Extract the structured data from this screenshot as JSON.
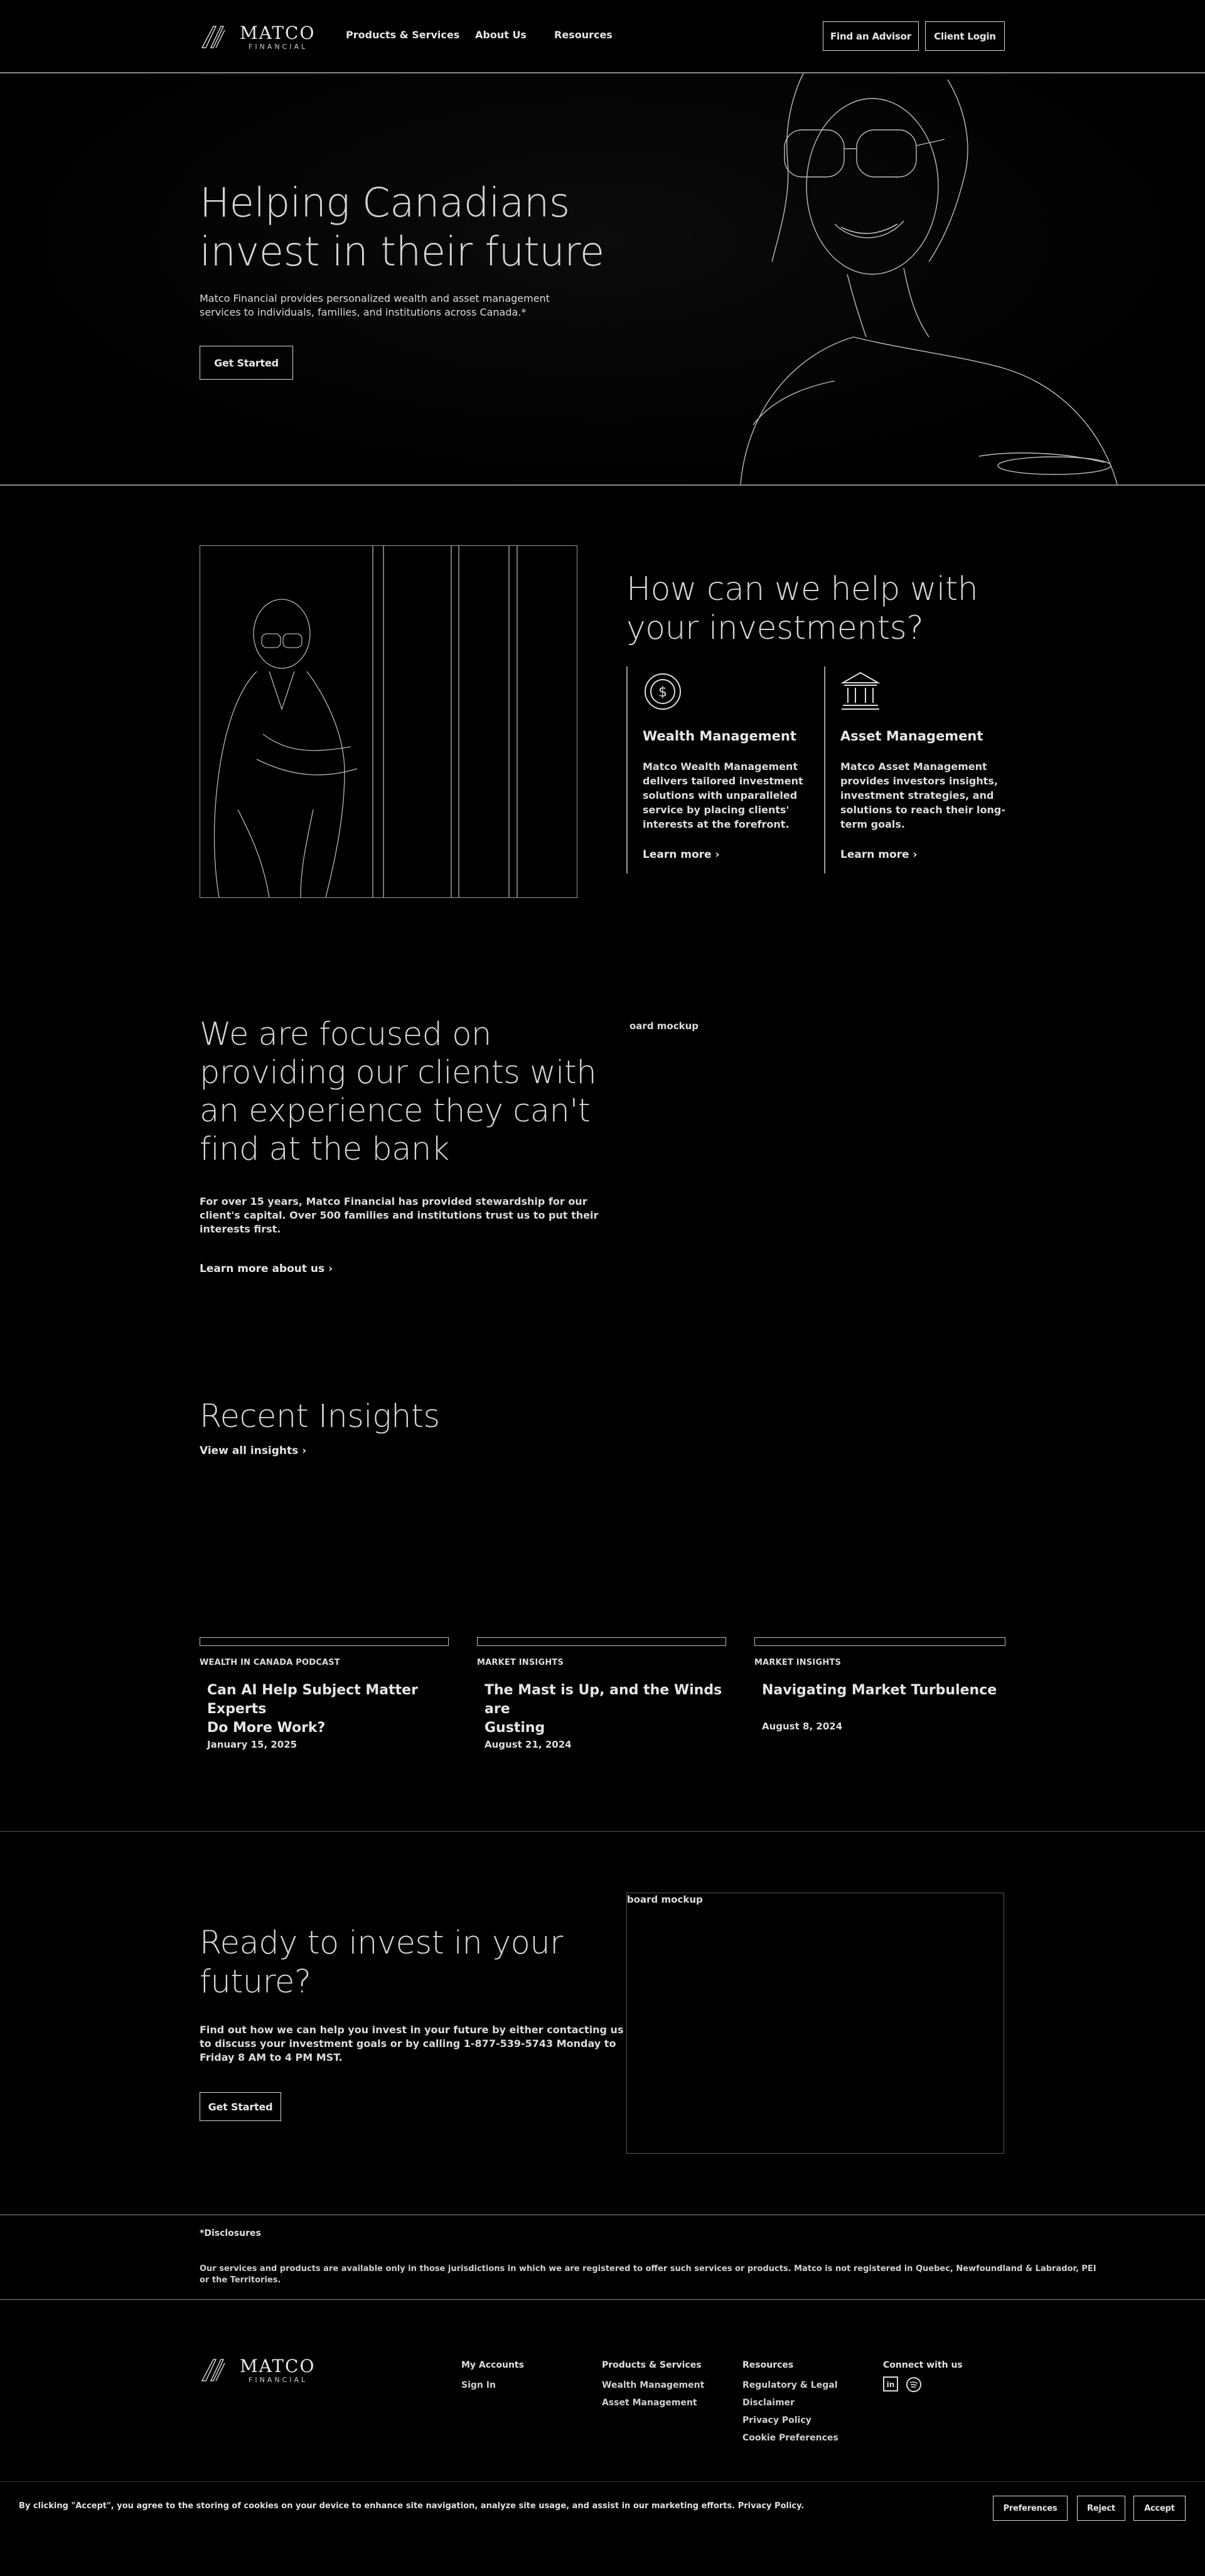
{
  "header": {
    "brand": "MATCO",
    "brand_sub": "FINANCIAL",
    "nav": [
      "Products & Services",
      "About Us",
      "Resources"
    ],
    "find_advisor": "Find an Advisor",
    "client_login": "Client Login"
  },
  "hero": {
    "title_line1": "Helping Canadians",
    "title_line2": "invest in their future",
    "body_line1": "Matco Financial provides personalized wealth and asset management",
    "body_line2": "services to individuals, families, and institutions across Canada.*",
    "cta": "Get Started"
  },
  "help": {
    "title_line1": "How can we help with",
    "title_line2": "your investments?",
    "services": [
      {
        "title": "Wealth Management",
        "lines": [
          "Matco Wealth Management",
          "delivers tailored investment",
          "solutions with unparalleled",
          "service by placing clients'",
          "interests at the forefront."
        ],
        "link": "Learn more"
      },
      {
        "title": "Asset Management",
        "lines": [
          "Matco Asset Management",
          "provides investors insights,",
          "investment strategies, and",
          "solutions to reach their long-",
          "term goals."
        ],
        "link": "Learn more"
      }
    ]
  },
  "focus": {
    "title_lines": [
      "We are focused on",
      "providing our clients with",
      "an experience they can't",
      "find at the bank"
    ],
    "body_lines": [
      "For over 15 years, Matco Financial has provided stewardship for our",
      "client's capital. Over 500 families and institutions trust us to put their",
      "interests first."
    ],
    "link": "Learn more about us",
    "mockup_label": "oard mockup"
  },
  "insights": {
    "title": "Recent Insights",
    "view_all": "View all insights",
    "cards": [
      {
        "category": "WEALTH IN CANADA PODCAST",
        "title_lines": [
          "Can AI Help Subject Matter Experts",
          "Do More Work?"
        ],
        "date": "January 15, 2025"
      },
      {
        "category": "MARKET INSIGHTS",
        "title_lines": [
          "The Mast is Up, and the Winds are",
          "Gusting"
        ],
        "date": "August 21, 2024"
      },
      {
        "category": "MARKET INSIGHTS",
        "title_lines": [
          "Navigating Market Turbulence"
        ],
        "date": "August 8, 2024"
      }
    ]
  },
  "ready": {
    "title_lines": [
      "Ready to invest in your",
      "future?"
    ],
    "body_lines": [
      "Find out how we can help you invest in your future by either contacting us",
      "to discuss your investment goals or by calling 1-877-539-5743 Monday to",
      "Friday 8 AM to 4 PM MST."
    ],
    "cta": "Get Started",
    "mockup_label": "board mockup"
  },
  "disclosures": {
    "title": "*Disclosures",
    "line1": "Our services and products are available only in those jurisdictions in which we are registered to offer such services or products. Matco is not registered in Quebec, Newfoundland & Labrador, PEI",
    "line2": "or the Territories."
  },
  "footer": {
    "brand": "MATCO",
    "brand_sub": "FINANCIAL",
    "accounts": {
      "title": "My Accounts",
      "items": [
        "Sign In"
      ]
    },
    "products": {
      "title": "Products & Services",
      "items": [
        "Wealth Management",
        "Asset Management"
      ]
    },
    "resources": {
      "title": "Resources",
      "items": [
        "Regulatory & Legal",
        "Disclaimer",
        "Privacy Policy",
        "Cookie Preferences"
      ]
    },
    "connect": {
      "title": "Connect with us"
    }
  },
  "cookie": {
    "text": "By clicking \"Accept\", you agree to the storing of cookies on your device to enhance site navigation, analyze site usage, and assist in our marketing efforts. Privacy Policy.",
    "preferences": "Preferences",
    "reject": "Reject",
    "accept": "Accept"
  }
}
